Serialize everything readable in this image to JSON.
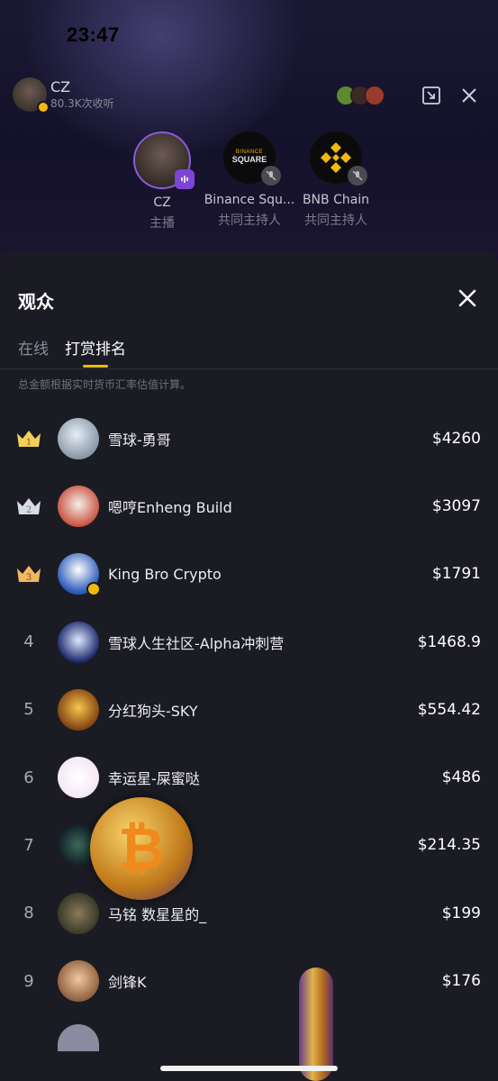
{
  "status": {
    "time": "23:47"
  },
  "host": {
    "name": "CZ",
    "listeners": "80.3K次收听"
  },
  "speakers": [
    {
      "name": "CZ",
      "role": "主播"
    },
    {
      "name": "Binance Squ...",
      "role": "共同主持人",
      "logo_line1": "BINANCE",
      "logo_line2": "SQUARE"
    },
    {
      "name": "BNB Chain",
      "role": "共同主持人"
    }
  ],
  "sheet": {
    "title": "观众",
    "tabs": [
      {
        "label": "在线"
      },
      {
        "label": "打赏排名"
      }
    ],
    "active_tab": "打赏排名",
    "note": "总金额根据实时货币汇率估值计算。"
  },
  "ranking": [
    {
      "rank": "1",
      "name": "雪球-勇哥",
      "amount": "$4260"
    },
    {
      "rank": "2",
      "name": "嗯哼Enheng Build",
      "amount": "$3097"
    },
    {
      "rank": "3",
      "name": "King Bro Crypto",
      "amount": "$1791"
    },
    {
      "rank": "4",
      "name": "雪球人生社区-Alpha冲刺营",
      "amount": "$1468.9"
    },
    {
      "rank": "5",
      "name": "分红狗头-SKY",
      "amount": "$554.42"
    },
    {
      "rank": "6",
      "name": "幸运星-屎蜜哒",
      "amount": "$486"
    },
    {
      "rank": "7",
      "name": "",
      "amount": "$214.35"
    },
    {
      "rank": "8",
      "name": "马铭       数星星的_",
      "amount": "$199"
    },
    {
      "rank": "9",
      "name": "剑锋K",
      "amount": "$176"
    }
  ],
  "colors": {
    "accent": "#f0b90b",
    "live": "#7d45d6",
    "sheet_bg": "#1b1c23"
  },
  "icons": [
    "close-icon",
    "minimize-icon",
    "crown-icon",
    "mic-muted-icon",
    "audio-wave-icon",
    "bitcoin-icon"
  ]
}
